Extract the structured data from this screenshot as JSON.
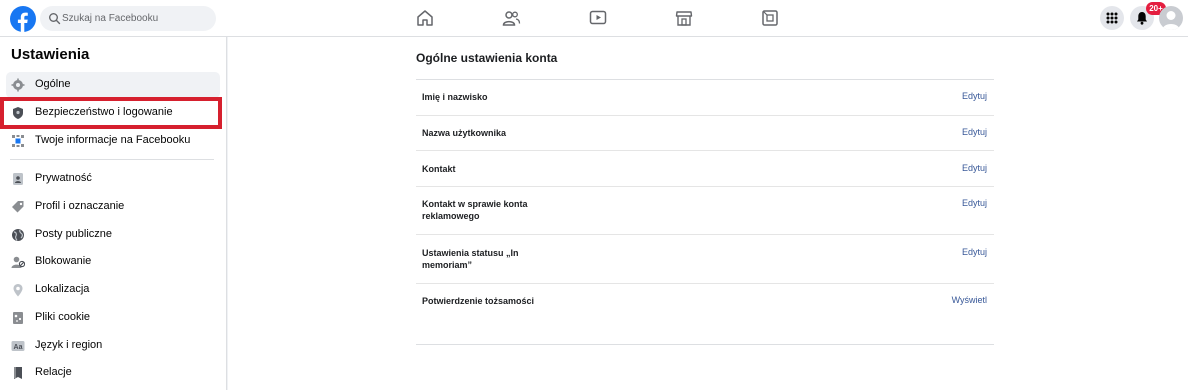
{
  "topbar": {
    "search_placeholder": "Szukaj na Facebooku",
    "notifications_badge": "20+",
    "nav_icons": [
      "home-icon",
      "friends-icon",
      "watch-icon",
      "marketplace-icon",
      "gaming-icon"
    ],
    "right_icons": [
      "menu-grid-icon",
      "notifications-bell-icon",
      "profile-avatar"
    ],
    "brand_color": "#1877f2"
  },
  "sidebar": {
    "title": "Ustawienia",
    "items": [
      {
        "label": "Ogólne",
        "icon": "gear-icon",
        "active": true
      },
      {
        "label": "Bezpieczeństwo i logowanie",
        "icon": "shield-icon",
        "highlighted": true
      },
      {
        "label": "Twoje informacje na Facebooku",
        "icon": "facebook-info-icon"
      },
      {
        "label": "Prywatność",
        "icon": "lock-icon"
      },
      {
        "label": "Profil i oznaczanie",
        "icon": "tag-icon"
      },
      {
        "label": "Posty publiczne",
        "icon": "globe-icon"
      },
      {
        "label": "Blokowanie",
        "icon": "block-user-icon"
      },
      {
        "label": "Lokalizacja",
        "icon": "location-pin-icon"
      },
      {
        "label": "Pliki cookie",
        "icon": "cookie-icon"
      },
      {
        "label": "Język i region",
        "icon": "language-icon"
      },
      {
        "label": "Relacje",
        "icon": "book-icon"
      }
    ],
    "highlight_color": "#d6202e"
  },
  "main": {
    "title": "Ogólne ustawienia konta",
    "rows": [
      {
        "label": "Imię i nazwisko",
        "action": "Edytuj"
      },
      {
        "label": "Nazwa użytkownika",
        "action": "Edytuj"
      },
      {
        "label": "Kontakt",
        "action": "Edytuj"
      },
      {
        "label": "Kontakt w sprawie konta reklamowego",
        "action": "Edytuj"
      },
      {
        "label": "Ustawienia statusu „In memoriam”",
        "action": "Edytuj"
      },
      {
        "label": "Potwierdzenie tożsamości",
        "action": "Wyświetl"
      }
    ],
    "link_color": "#385898"
  }
}
